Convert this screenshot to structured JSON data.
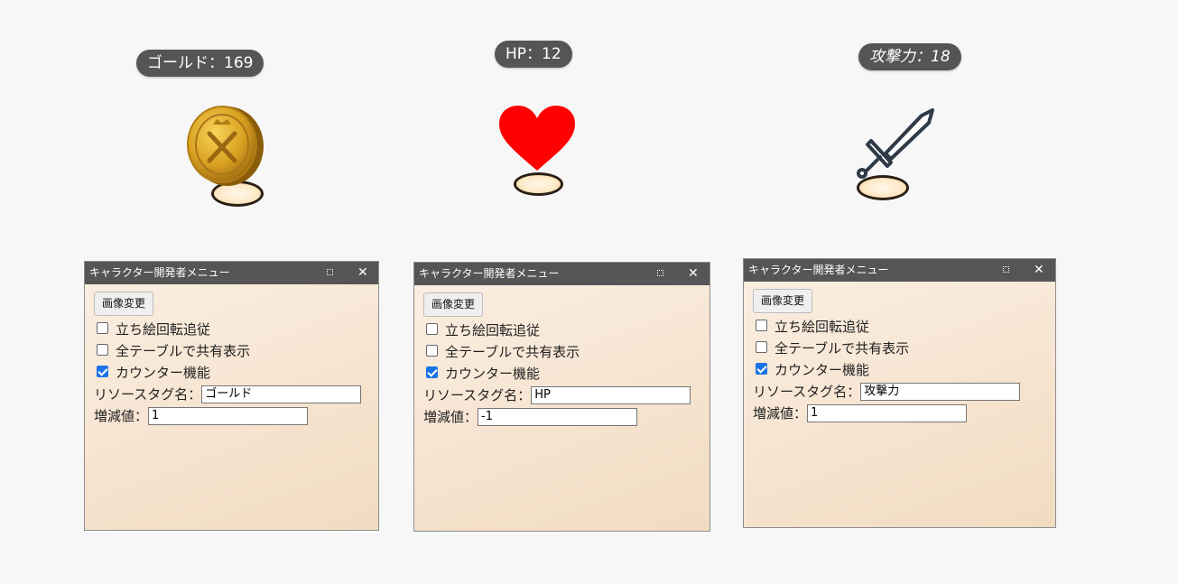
{
  "characters": [
    {
      "badge": "ゴールド：169",
      "icon": "gold-coin"
    },
    {
      "badge": "HP：12",
      "icon": "heart"
    },
    {
      "badge": "攻撃力：18",
      "icon": "sword"
    }
  ],
  "panels": [
    {
      "title": "キャラクター開発者メニュー",
      "change_image": "画像変更",
      "option1": "立ち絵回転追従",
      "option1_checked": false,
      "option2": "全テーブルで共有表示",
      "option2_checked": false,
      "option3": "カウンター機能",
      "option3_checked": true,
      "resource_label": "リソースタグ名：",
      "resource_value": "ゴールド",
      "delta_label": "増減値：",
      "delta_value": "1"
    },
    {
      "title": "キャラクター開発者メニュー",
      "change_image": "画像変更",
      "option1": "立ち絵回転追従",
      "option1_checked": false,
      "option2": "全テーブルで共有表示",
      "option2_checked": false,
      "option3": "カウンター機能",
      "option3_checked": true,
      "resource_label": "リソースタグ名：",
      "resource_value": "HP",
      "delta_label": "増減値：",
      "delta_value": "-1"
    },
    {
      "title": "キャラクター開発者メニュー",
      "change_image": "画像変更",
      "option1": "立ち絵回転追従",
      "option1_checked": false,
      "option2": "全テーブルで共有表示",
      "option2_checked": false,
      "option3": "カウンター機能",
      "option3_checked": true,
      "resource_label": "リソースタグ名：",
      "resource_value": "攻撃力",
      "delta_label": "増減値：",
      "delta_value": "1"
    }
  ],
  "colors": {
    "badge_bg": "#555555",
    "titlebar_bg": "#555555",
    "heart": "#ff0000",
    "coin": "#d9a020",
    "checkbox": "#1a73e8"
  }
}
